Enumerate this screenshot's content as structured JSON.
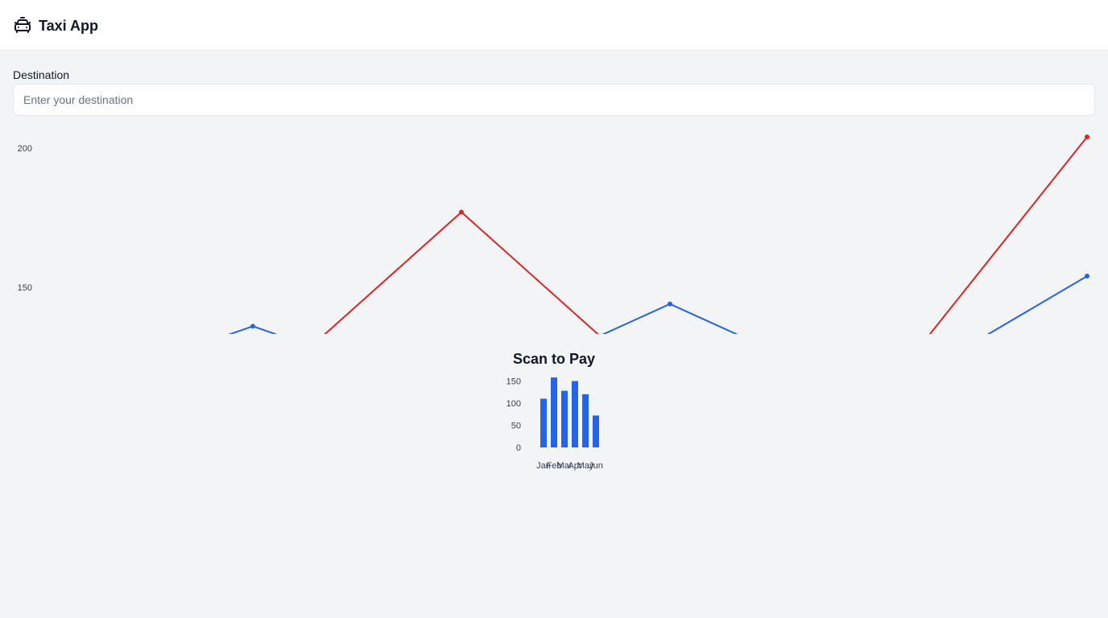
{
  "header": {
    "title": "Taxi App",
    "icon": "taxi-icon"
  },
  "destination": {
    "label": "Destination",
    "placeholder": "Enter your destination",
    "value": ""
  },
  "qr_section": {
    "title": "Scan to Pay"
  },
  "colors": {
    "blue": "#2563eb",
    "red": "#dc2626"
  },
  "chart_data": [
    {
      "type": "line",
      "title": "",
      "y_ticks": [
        200,
        150
      ],
      "x": [
        0,
        1,
        2,
        3,
        4,
        5
      ],
      "ylim": [
        150,
        200
      ],
      "series": [
        {
          "values": [
            null,
            136,
            null,
            144,
            null,
            154
          ],
          "color": "#2563eb"
        },
        {
          "values": [
            null,
            null,
            177,
            null,
            null,
            204
          ],
          "color": "#dc2626"
        }
      ],
      "grid": false,
      "legend": "none"
    },
    {
      "type": "bar",
      "categories": [
        "Jan",
        "Feb",
        "Mar",
        "Apr",
        "May",
        "Jun"
      ],
      "values": [
        110,
        158,
        128,
        150,
        120,
        72
      ],
      "y_ticks": [
        0,
        50,
        100,
        150
      ],
      "ylim": [
        0,
        160
      ],
      "color": "#2563eb",
      "grid": false,
      "legend": "none"
    }
  ]
}
